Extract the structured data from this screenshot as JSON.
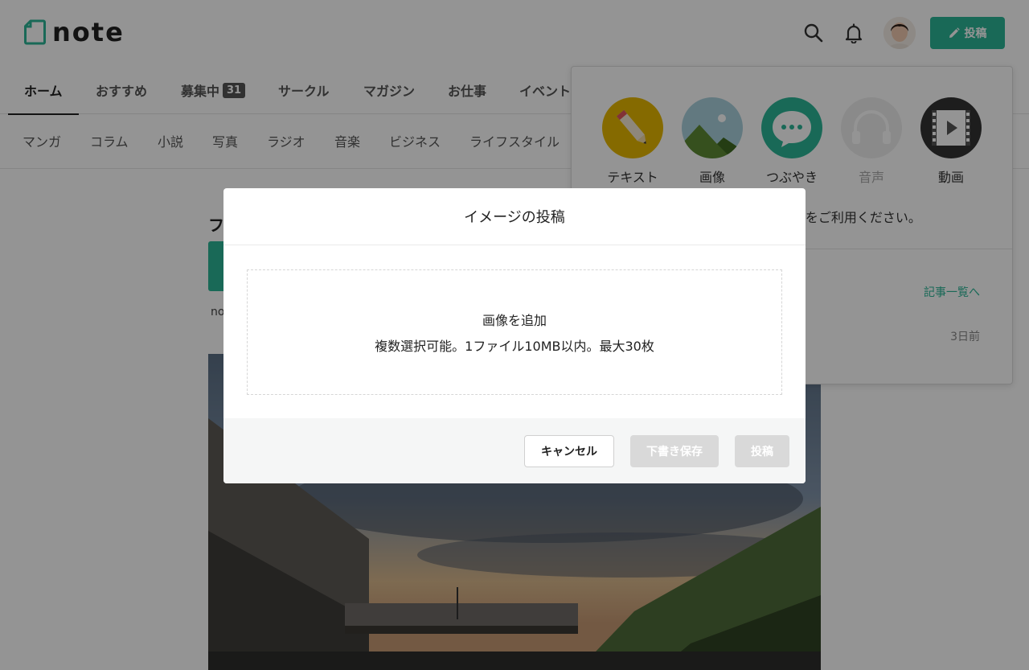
{
  "header": {
    "logo_text": "note",
    "post_button_label": "投稿"
  },
  "tabs": [
    {
      "label": "ホーム",
      "active": true
    },
    {
      "label": "おすすめ"
    },
    {
      "label": "募集中",
      "badge": "31"
    },
    {
      "label": "サークル"
    },
    {
      "label": "マガジン"
    },
    {
      "label": "お仕事"
    },
    {
      "label": "イベント"
    }
  ],
  "categories": [
    "マンガ",
    "コラム",
    "小説",
    "写真",
    "ラジオ",
    "音楽",
    "ビジネス",
    "ライフスタイル"
  ],
  "feed": {
    "heading": "フ",
    "author_prefix": "no"
  },
  "post_menu": {
    "items": [
      {
        "label": "テキスト",
        "icon": "pencil-icon",
        "color": "#e5b700"
      },
      {
        "label": "画像",
        "icon": "image-icon",
        "color": "#a9d0dc"
      },
      {
        "label": "つぶやき",
        "icon": "speech-bubble-icon",
        "color": "#2cb696"
      },
      {
        "label": "音声",
        "icon": "headphones-icon",
        "color": "#eeeeee",
        "disabled": true
      },
      {
        "label": "動画",
        "icon": "video-icon",
        "color": "#333333"
      }
    ],
    "note": "PCをご利用ください。",
    "articles_link": "記事一覧へ",
    "time": "3日前"
  },
  "modal": {
    "title": "イメージの投稿",
    "dropzone_title": "画像を追加",
    "dropzone_desc": "複数選択可能。1ファイル10MB以内。最大30枚",
    "cancel_label": "キャンセル",
    "draft_label": "下書き保存",
    "post_label": "投稿"
  },
  "colors": {
    "accent": "#2cb696",
    "overlay": "rgba(0,0,0,0.42)"
  }
}
